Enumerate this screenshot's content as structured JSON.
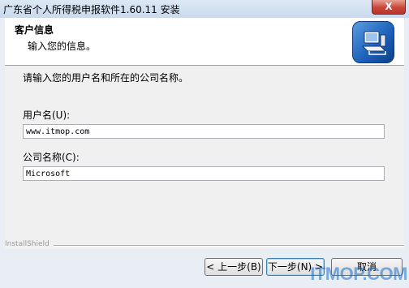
{
  "window": {
    "title": "广东省个人所得税申报软件1.60.11 安装",
    "close_label": "X"
  },
  "header": {
    "title": "客户信息",
    "subtitle": "输入您的信息。",
    "icon": "installer-computer-icon"
  },
  "form": {
    "prompt": "请输入您的用户名和所在的公司名称。",
    "username_label": "用户名(U):",
    "username_value": "www.itmop.com",
    "company_label": "公司名称(C):",
    "company_value": "Microsoft"
  },
  "footer": {
    "brand": "InstallShield",
    "back_label": "< 上一步(B)",
    "next_label": "下一步(N) >",
    "cancel_label": "取消"
  },
  "watermark": {
    "text": "ITMOP.COM"
  },
  "colors": {
    "accent": "#1a5fb8",
    "close": "#c9463a"
  }
}
